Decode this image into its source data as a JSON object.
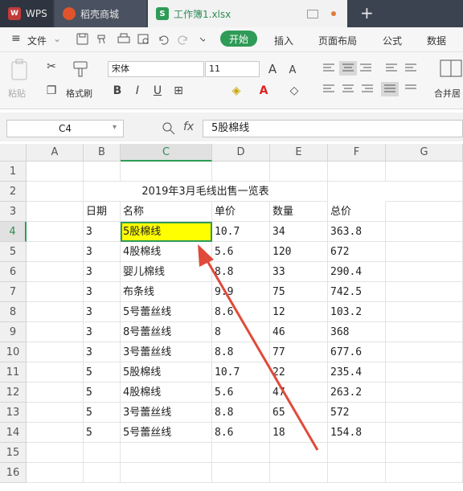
{
  "tabs": {
    "wps_label": "WPS",
    "store_label": "稻壳商城",
    "doc_label": "工作簿1.xlsx"
  },
  "menu": {
    "file_label": "文件",
    "items": [
      "开始",
      "插入",
      "页面布局",
      "公式",
      "数据"
    ]
  },
  "ribbon": {
    "paste_label": "粘贴",
    "format_painter_label": "格式刷",
    "font_name": "宋体",
    "font_size": "11",
    "merge_label": "合并居"
  },
  "formula_bar": {
    "cell_ref": "C4",
    "fx_label": "fx",
    "content": "5股棉线"
  },
  "columns": [
    "A",
    "B",
    "C",
    "D",
    "E",
    "F",
    "G"
  ],
  "rows": [
    "1",
    "2",
    "3",
    "4",
    "5",
    "6",
    "7",
    "8",
    "9",
    "10",
    "11",
    "12",
    "13",
    "14",
    "15",
    "16"
  ],
  "sheet": {
    "title": "2019年3月毛线出售一览表",
    "headers": [
      "日期",
      "名称",
      "单价",
      "数量",
      "总价"
    ],
    "records": [
      [
        "3",
        "5股棉线",
        "10.7",
        "34",
        "363.8"
      ],
      [
        "3",
        "4股棉线",
        "5.6",
        "120",
        "672"
      ],
      [
        "3",
        "婴儿棉线",
        "8.8",
        "33",
        "290.4"
      ],
      [
        "3",
        "布条线",
        "9.9",
        "75",
        "742.5"
      ],
      [
        "3",
        "5号蕾丝线",
        "8.6",
        "12",
        "103.2"
      ],
      [
        "3",
        "8号蕾丝线",
        "8",
        "46",
        "368"
      ],
      [
        "3",
        "3号蕾丝线",
        "8.8",
        "77",
        "677.6"
      ],
      [
        "5",
        "5股棉线",
        "10.7",
        "22",
        "235.4"
      ],
      [
        "5",
        "4股棉线",
        "5.6",
        "47",
        "263.2"
      ],
      [
        "5",
        "3号蕾丝线",
        "8.8",
        "65",
        "572"
      ],
      [
        "5",
        "5号蕾丝线",
        "8.6",
        "18",
        "154.8"
      ]
    ]
  },
  "accent_color": "#2e9b57",
  "highlight_color": "#ffff00",
  "annotation_arrow_color": "#e04a3a"
}
